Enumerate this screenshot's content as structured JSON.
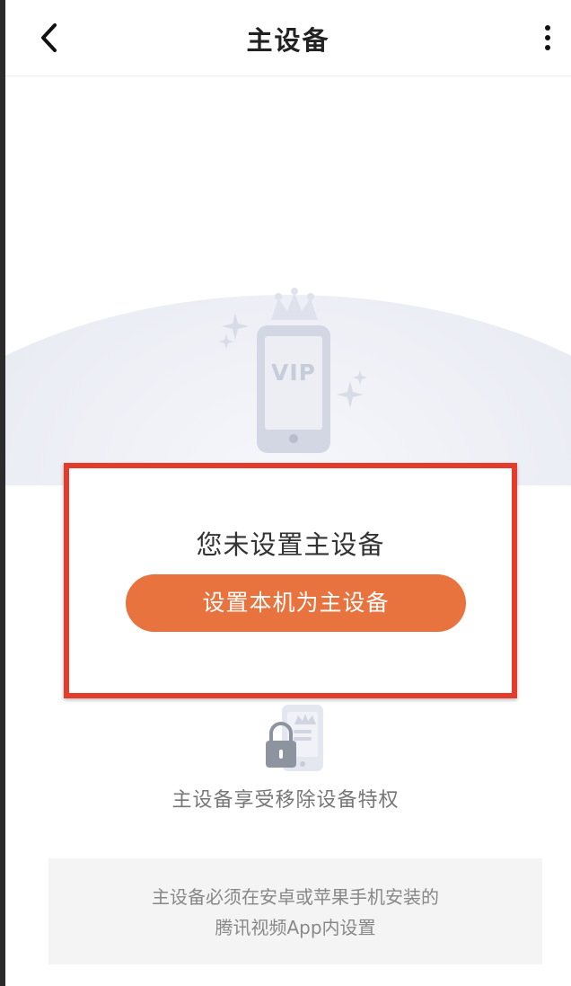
{
  "header": {
    "back_icon": "chevron-left-icon",
    "title": "主设备",
    "more_icon": "more-vertical-icon"
  },
  "hero": {
    "illustration_icon": "vip-phone-crown-icon",
    "vip_text": "VIP"
  },
  "callout": {
    "notice": "您未设置主设备",
    "button_label": "设置本机为主设备",
    "border_color": "#e33c2c",
    "button_color": "#e8733e"
  },
  "privilege": {
    "icon": "lock-phone-icon",
    "text": "主设备享受移除设备特权"
  },
  "info": {
    "line1": "主设备必须在安卓或苹果手机安装的",
    "line2": "腾讯视频App内设置"
  }
}
